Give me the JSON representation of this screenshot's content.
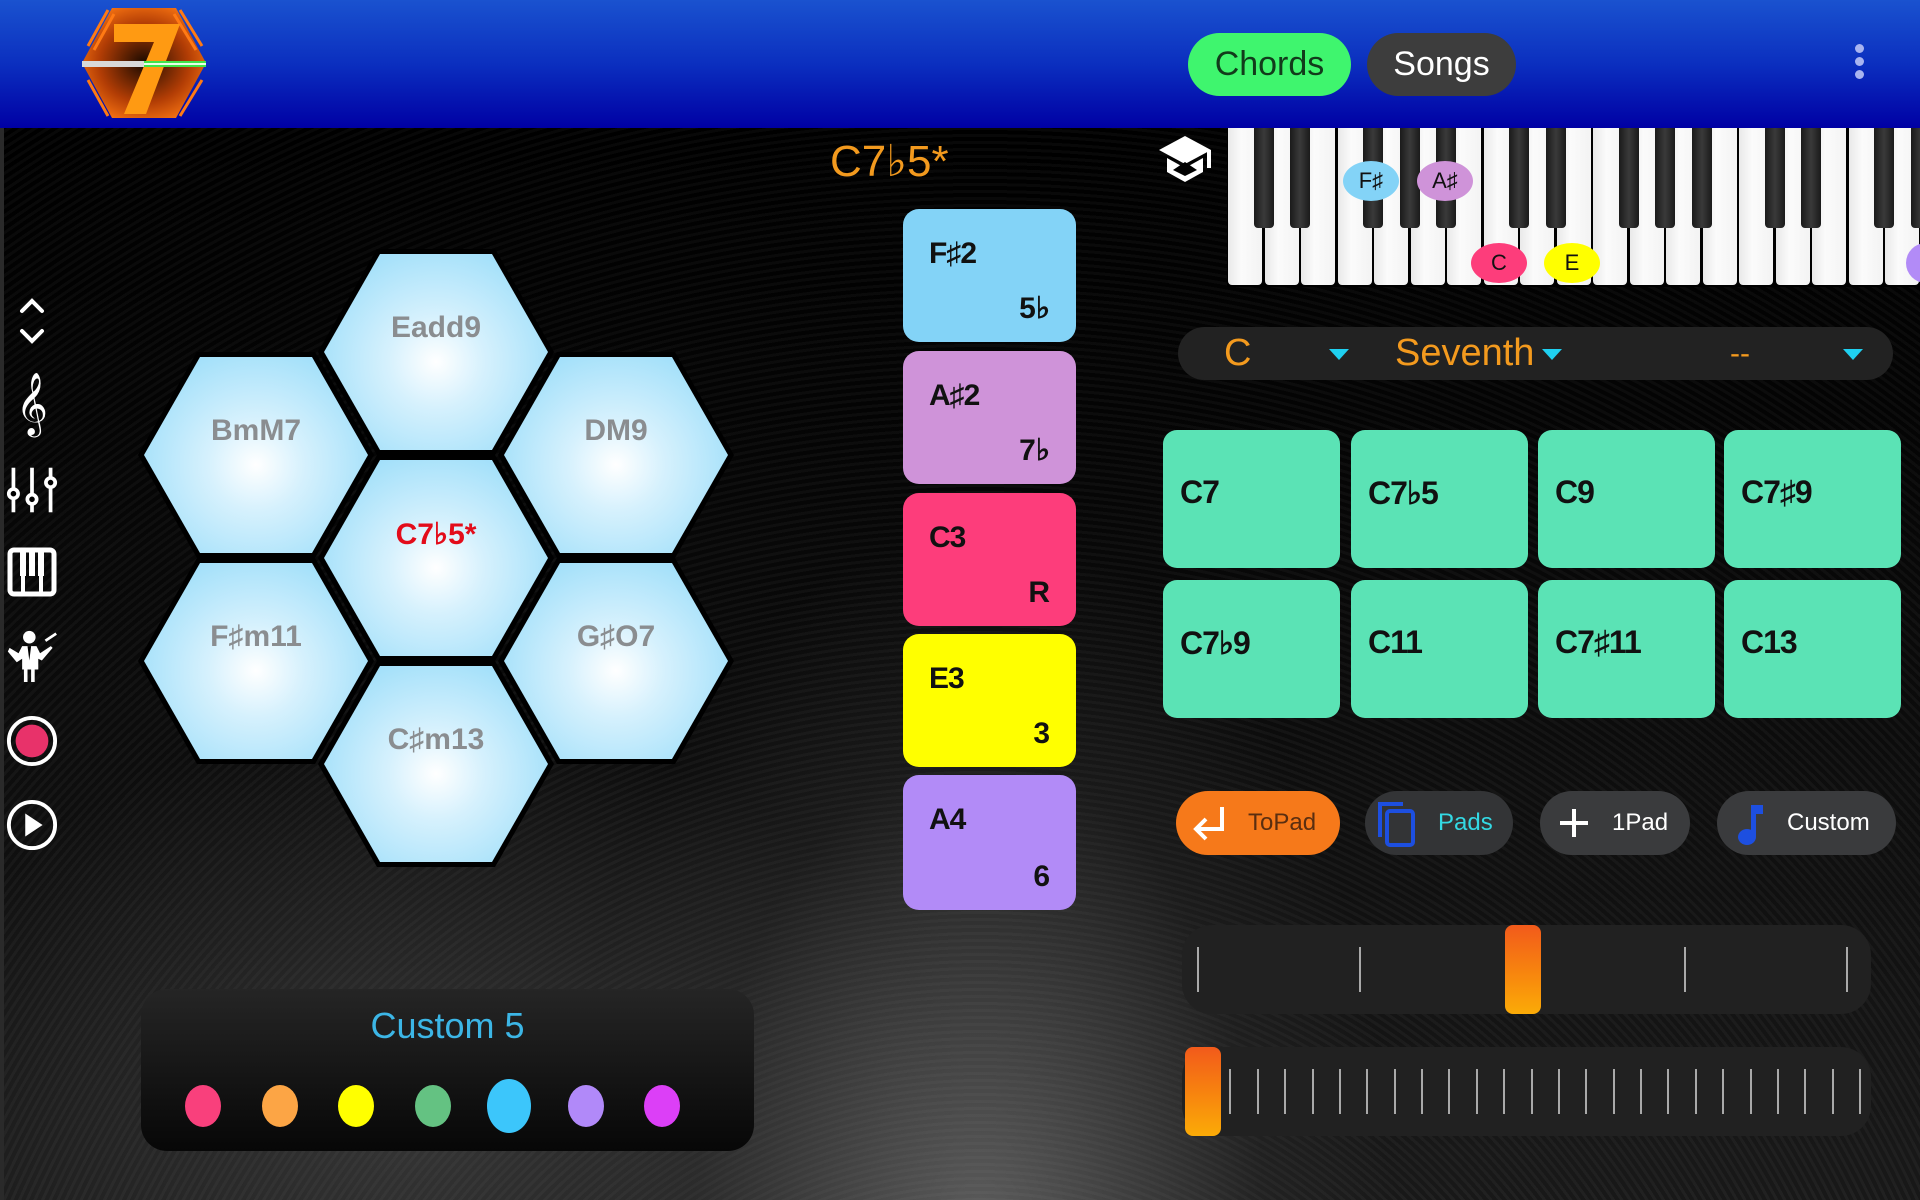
{
  "header": {
    "logo_label": "7",
    "tabs": [
      {
        "label": "Chords",
        "active": true
      },
      {
        "label": "Songs",
        "active": false
      }
    ],
    "menu_icon": "more-vert-icon"
  },
  "sidebar": {
    "items": [
      {
        "name": "scroll-up-down",
        "icon": "chevron-up-down-icon"
      },
      {
        "name": "treble-clef",
        "icon": "treble-clef-icon"
      },
      {
        "name": "mixer",
        "icon": "sliders-icon"
      },
      {
        "name": "piano",
        "icon": "piano-icon"
      },
      {
        "name": "conductor",
        "icon": "conductor-icon"
      },
      {
        "name": "record",
        "icon": "record-icon"
      },
      {
        "name": "play",
        "icon": "play-icon"
      }
    ]
  },
  "current_chord": "C7♭5*",
  "hex_chords": [
    {
      "label": "Eadd9",
      "selected": false
    },
    {
      "label": "BmM7",
      "selected": false
    },
    {
      "label": "DM9",
      "selected": false
    },
    {
      "label": "C7♭5*",
      "selected": true
    },
    {
      "label": "F♯m11",
      "selected": false
    },
    {
      "label": "G♯O7",
      "selected": false
    },
    {
      "label": "C♯m13",
      "selected": false
    }
  ],
  "note_pads": [
    {
      "note": "F♯2",
      "degree": "5♭",
      "color": "#83d3f7"
    },
    {
      "note": "A♯2",
      "degree": "7♭",
      "color": "#cf93d9"
    },
    {
      "note": "C3",
      "degree": "R",
      "color": "#fd3d7b"
    },
    {
      "note": "E3",
      "degree": "3",
      "color": "#ffff00"
    },
    {
      "note": "A4",
      "degree": "6",
      "color": "#b28bf7"
    }
  ],
  "keyboard": {
    "highlighted": [
      {
        "label": "F♯",
        "color": "#83d3f7"
      },
      {
        "label": "A♯",
        "color": "#cf93d9"
      },
      {
        "label": "C",
        "color": "#fd3d7b"
      },
      {
        "label": "E",
        "color": "#ffff00"
      },
      {
        "label": "",
        "color": "#b28bf7"
      }
    ]
  },
  "selectors": {
    "root": "C",
    "type": "Seventh",
    "extension": "--"
  },
  "chord_grid": [
    "C7",
    "C7♭5",
    "C9",
    "C7♯9",
    "C7♭9",
    "C11",
    "C7♯11",
    "C13"
  ],
  "actions": [
    {
      "label": "ToPad",
      "icon": "return-arrow-icon"
    },
    {
      "label": "Pads",
      "icon": "copy-pages-icon"
    },
    {
      "label": "1Pad",
      "icon": "plus-icon"
    },
    {
      "label": "Custom",
      "icon": "music-note-icon"
    }
  ],
  "sliders": [
    {
      "name": "slider-1",
      "ticks": 5,
      "value_index": 2
    },
    {
      "name": "slider-2",
      "ticks": 25,
      "value_index": 0
    }
  ],
  "custom_palette": {
    "title": "Custom 5",
    "colors": [
      "#f9407c",
      "#fca545",
      "#ffff00",
      "#64c282",
      "#3cc6fb",
      "#b189f9",
      "#dc3ff7"
    ],
    "selected_index": 4
  },
  "colors": {
    "accent_orange": "#f39a1e",
    "active_tab": "#3ff56e",
    "chord_cell": "#5be3b5",
    "selected_chord_text": "#e30c1a"
  }
}
